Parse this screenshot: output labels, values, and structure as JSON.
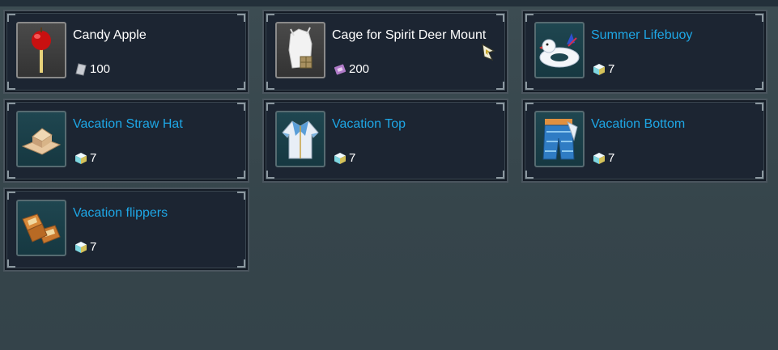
{
  "items": [
    {
      "name": "Candy Apple",
      "price": "100",
      "currency_icon": "crystal-currency-icon",
      "icon": "candy-apple-icon",
      "name_color": "#ffffff"
    },
    {
      "name": "Cage for Spirit Deer Mount",
      "price": "200",
      "currency_icon": "ticket-currency-icon",
      "icon": "spirit-deer-cage-icon",
      "name_color": "#ffffff"
    },
    {
      "name": "Summer Lifebuoy",
      "price": "7",
      "currency_icon": "cube-currency-icon",
      "icon": "lifebuoy-icon",
      "name_color": "#1ea7e6"
    },
    {
      "name": "Vacation Straw Hat",
      "price": "7",
      "currency_icon": "cube-currency-icon",
      "icon": "straw-hat-icon",
      "name_color": "#1ea7e6"
    },
    {
      "name": "Vacation Top",
      "price": "7",
      "currency_icon": "cube-currency-icon",
      "icon": "vacation-top-icon",
      "name_color": "#1ea7e6"
    },
    {
      "name": "Vacation Bottom",
      "price": "7",
      "currency_icon": "cube-currency-icon",
      "icon": "vacation-bottom-icon",
      "name_color": "#1ea7e6"
    },
    {
      "name": "Vacation flippers",
      "price": "7",
      "currency_icon": "cube-currency-icon",
      "icon": "flippers-icon",
      "name_color": "#1ea7e6"
    }
  ]
}
